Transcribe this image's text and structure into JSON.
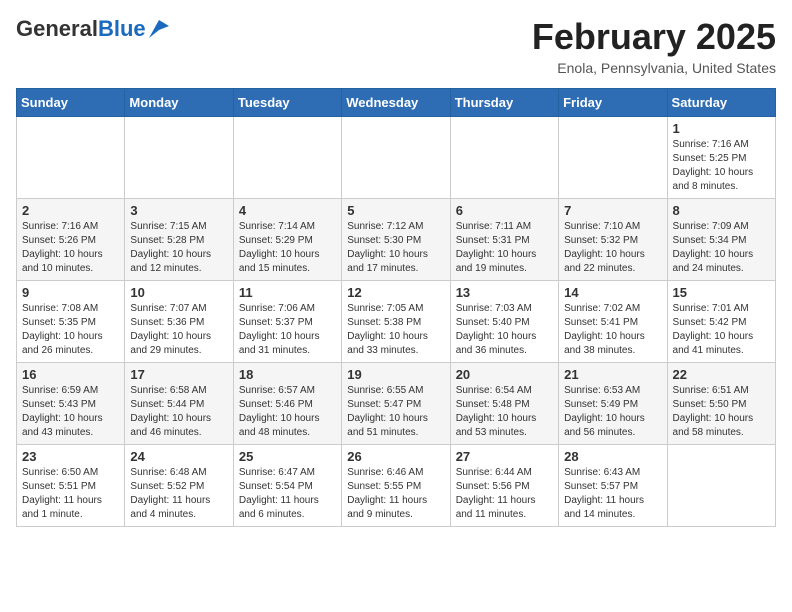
{
  "header": {
    "logo_general": "General",
    "logo_blue": "Blue",
    "month_title": "February 2025",
    "location": "Enola, Pennsylvania, United States"
  },
  "weekdays": [
    "Sunday",
    "Monday",
    "Tuesday",
    "Wednesday",
    "Thursday",
    "Friday",
    "Saturday"
  ],
  "weeks": [
    [
      {
        "day": "",
        "info": ""
      },
      {
        "day": "",
        "info": ""
      },
      {
        "day": "",
        "info": ""
      },
      {
        "day": "",
        "info": ""
      },
      {
        "day": "",
        "info": ""
      },
      {
        "day": "",
        "info": ""
      },
      {
        "day": "1",
        "info": "Sunrise: 7:16 AM\nSunset: 5:25 PM\nDaylight: 10 hours\nand 8 minutes."
      }
    ],
    [
      {
        "day": "2",
        "info": "Sunrise: 7:16 AM\nSunset: 5:26 PM\nDaylight: 10 hours\nand 10 minutes."
      },
      {
        "day": "3",
        "info": "Sunrise: 7:15 AM\nSunset: 5:28 PM\nDaylight: 10 hours\nand 12 minutes."
      },
      {
        "day": "4",
        "info": "Sunrise: 7:14 AM\nSunset: 5:29 PM\nDaylight: 10 hours\nand 15 minutes."
      },
      {
        "day": "5",
        "info": "Sunrise: 7:12 AM\nSunset: 5:30 PM\nDaylight: 10 hours\nand 17 minutes."
      },
      {
        "day": "6",
        "info": "Sunrise: 7:11 AM\nSunset: 5:31 PM\nDaylight: 10 hours\nand 19 minutes."
      },
      {
        "day": "7",
        "info": "Sunrise: 7:10 AM\nSunset: 5:32 PM\nDaylight: 10 hours\nand 22 minutes."
      },
      {
        "day": "8",
        "info": "Sunrise: 7:09 AM\nSunset: 5:34 PM\nDaylight: 10 hours\nand 24 minutes."
      }
    ],
    [
      {
        "day": "9",
        "info": "Sunrise: 7:08 AM\nSunset: 5:35 PM\nDaylight: 10 hours\nand 26 minutes."
      },
      {
        "day": "10",
        "info": "Sunrise: 7:07 AM\nSunset: 5:36 PM\nDaylight: 10 hours\nand 29 minutes."
      },
      {
        "day": "11",
        "info": "Sunrise: 7:06 AM\nSunset: 5:37 PM\nDaylight: 10 hours\nand 31 minutes."
      },
      {
        "day": "12",
        "info": "Sunrise: 7:05 AM\nSunset: 5:38 PM\nDaylight: 10 hours\nand 33 minutes."
      },
      {
        "day": "13",
        "info": "Sunrise: 7:03 AM\nSunset: 5:40 PM\nDaylight: 10 hours\nand 36 minutes."
      },
      {
        "day": "14",
        "info": "Sunrise: 7:02 AM\nSunset: 5:41 PM\nDaylight: 10 hours\nand 38 minutes."
      },
      {
        "day": "15",
        "info": "Sunrise: 7:01 AM\nSunset: 5:42 PM\nDaylight: 10 hours\nand 41 minutes."
      }
    ],
    [
      {
        "day": "16",
        "info": "Sunrise: 6:59 AM\nSunset: 5:43 PM\nDaylight: 10 hours\nand 43 minutes."
      },
      {
        "day": "17",
        "info": "Sunrise: 6:58 AM\nSunset: 5:44 PM\nDaylight: 10 hours\nand 46 minutes."
      },
      {
        "day": "18",
        "info": "Sunrise: 6:57 AM\nSunset: 5:46 PM\nDaylight: 10 hours\nand 48 minutes."
      },
      {
        "day": "19",
        "info": "Sunrise: 6:55 AM\nSunset: 5:47 PM\nDaylight: 10 hours\nand 51 minutes."
      },
      {
        "day": "20",
        "info": "Sunrise: 6:54 AM\nSunset: 5:48 PM\nDaylight: 10 hours\nand 53 minutes."
      },
      {
        "day": "21",
        "info": "Sunrise: 6:53 AM\nSunset: 5:49 PM\nDaylight: 10 hours\nand 56 minutes."
      },
      {
        "day": "22",
        "info": "Sunrise: 6:51 AM\nSunset: 5:50 PM\nDaylight: 10 hours\nand 58 minutes."
      }
    ],
    [
      {
        "day": "23",
        "info": "Sunrise: 6:50 AM\nSunset: 5:51 PM\nDaylight: 11 hours\nand 1 minute."
      },
      {
        "day": "24",
        "info": "Sunrise: 6:48 AM\nSunset: 5:52 PM\nDaylight: 11 hours\nand 4 minutes."
      },
      {
        "day": "25",
        "info": "Sunrise: 6:47 AM\nSunset: 5:54 PM\nDaylight: 11 hours\nand 6 minutes."
      },
      {
        "day": "26",
        "info": "Sunrise: 6:46 AM\nSunset: 5:55 PM\nDaylight: 11 hours\nand 9 minutes."
      },
      {
        "day": "27",
        "info": "Sunrise: 6:44 AM\nSunset: 5:56 PM\nDaylight: 11 hours\nand 11 minutes."
      },
      {
        "day": "28",
        "info": "Sunrise: 6:43 AM\nSunset: 5:57 PM\nDaylight: 11 hours\nand 14 minutes."
      },
      {
        "day": "",
        "info": ""
      }
    ]
  ]
}
